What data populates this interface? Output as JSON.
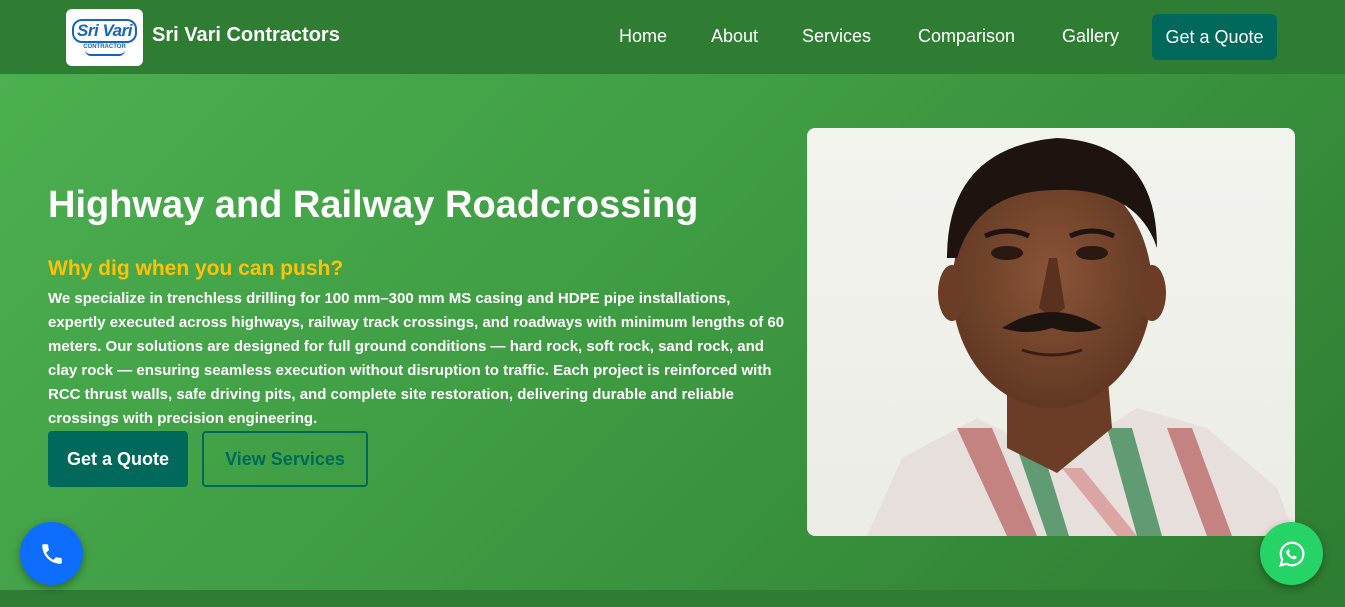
{
  "brand": {
    "logo_text": "Sri Vari",
    "logo_sub": "CONTRACTOR",
    "name": "Sri Vari Contractors"
  },
  "nav": {
    "items": [
      {
        "label": "Home"
      },
      {
        "label": "About"
      },
      {
        "label": "Services"
      },
      {
        "label": "Comparison"
      },
      {
        "label": "Gallery"
      }
    ],
    "cta_label": "Get a Quote"
  },
  "hero": {
    "title": "Highway and Railway Roadcrossing",
    "subtitle": "Why dig when you can push?",
    "description": "We specialize in trenchless drilling for 100 mm–300 mm MS casing and HDPE pipe installations, expertly executed across highways, railway track crossings, and roadways with minimum lengths of 60 meters. Our solutions are designed for full ground conditions — hard rock, soft rock, sand rock, and clay rock — ensuring seamless execution without disruption to traffic. Each project is reinforced with RCC thrust walls, safe driving pits, and complete site restoration, delivering durable and reliable crossings with precision engineering.",
    "primary_button": "Get a Quote",
    "secondary_button": "View Services"
  },
  "floating": {
    "phone_icon": "phone-icon",
    "whatsapp_icon": "whatsapp-icon"
  },
  "colors": {
    "header_bg": "#2e7d32",
    "hero_gradient_start": "#4caf50",
    "accent_teal": "#00695c",
    "highlight_yellow": "#ffc107",
    "phone_fab": "#0d6efd",
    "whatsapp_fab": "#25d366"
  }
}
